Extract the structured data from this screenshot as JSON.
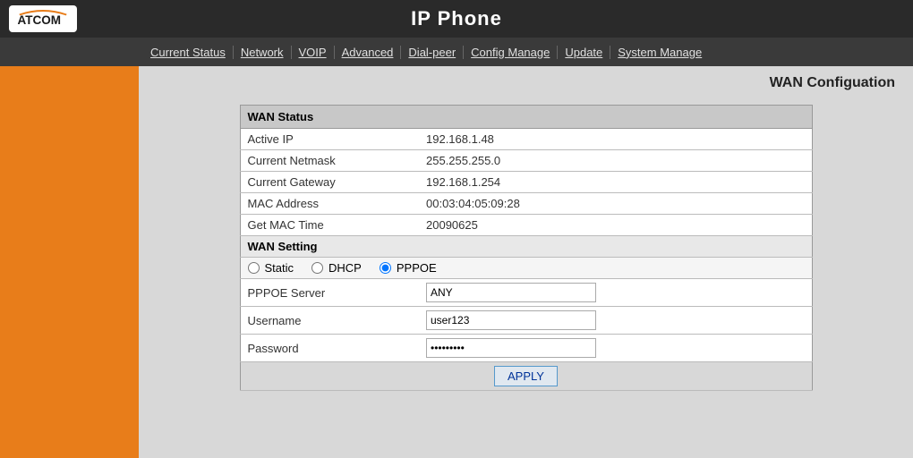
{
  "header": {
    "title": "IP Phone",
    "logo": "ATCOM"
  },
  "navbar": {
    "items": [
      {
        "label": "Current Status",
        "id": "current-status"
      },
      {
        "label": "Network",
        "id": "network"
      },
      {
        "label": "VOIP",
        "id": "voip"
      },
      {
        "label": "Advanced",
        "id": "advanced"
      },
      {
        "label": "Dial-peer",
        "id": "dial-peer"
      },
      {
        "label": "Config Manage",
        "id": "config-manage"
      },
      {
        "label": "Update",
        "id": "update"
      },
      {
        "label": "System Manage",
        "id": "system-manage"
      }
    ]
  },
  "page": {
    "heading": "WAN Configuation"
  },
  "wan_status": {
    "section_title": "WAN Status",
    "fields": [
      {
        "label": "Active IP",
        "value": "192.168.1.48"
      },
      {
        "label": "Current Netmask",
        "value": "255.255.255.0"
      },
      {
        "label": "Current Gateway",
        "value": "192.168.1.254"
      },
      {
        "label": "MAC Address",
        "value": "00:03:04:05:09:28"
      },
      {
        "label": "Get MAC Time",
        "value": "20090625"
      }
    ],
    "wan_setting_label": "WAN Setting",
    "radio_options": {
      "static": "Static",
      "dhcp": "DHCP",
      "pppoe": "PPPOE",
      "selected": "pppoe"
    },
    "form_fields": [
      {
        "id": "pppoe-server",
        "label": "PPPOE Server",
        "type": "text",
        "value": "ANY"
      },
      {
        "id": "username",
        "label": "Username",
        "type": "text",
        "value": "user123"
      },
      {
        "id": "password",
        "label": "Password",
        "type": "password",
        "value": "••••••••"
      }
    ],
    "apply_button": "APPLY"
  }
}
